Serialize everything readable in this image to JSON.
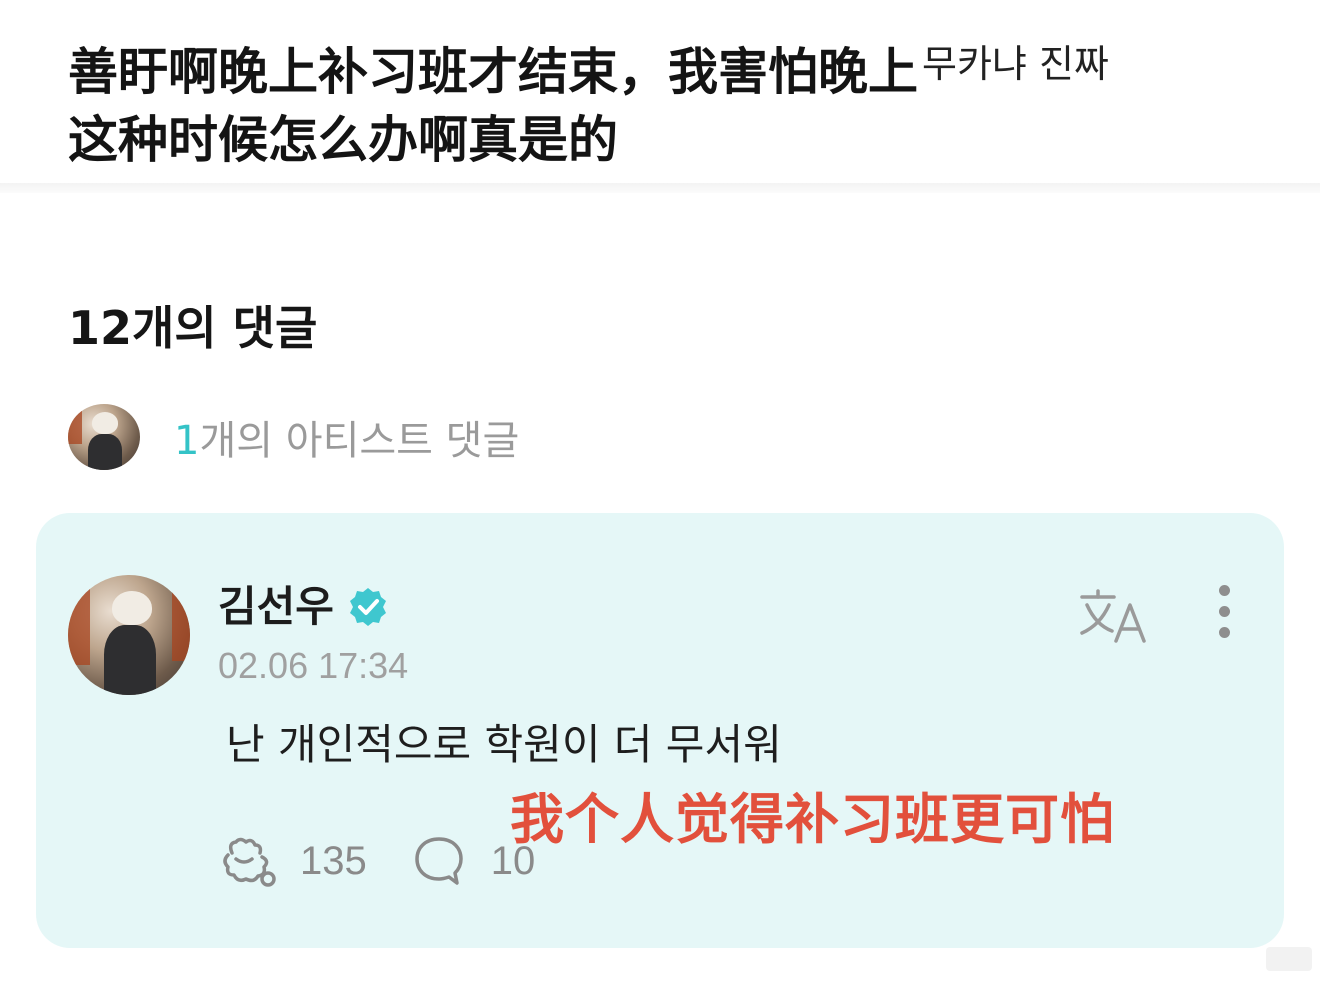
{
  "post": {
    "line1": "善盱啊晚上补习班才结束，我害怕晚上",
    "overlay_korean": "무카냐 진짜",
    "line2": "这种时候怎么办啊真是的"
  },
  "comments": {
    "count_label": "12개의 댓글",
    "artist_count": "1",
    "artist_label": "개의 아티스트 댓글"
  },
  "comment": {
    "author": "김선우",
    "timestamp": "02.06 17:34",
    "text": "난 개인적으로 학원이 더 무서워",
    "translation_overlay": "我个人觉得补习班更可怕",
    "likes": "135",
    "replies": "10"
  },
  "icons": {
    "verified": "verified-badge-icon",
    "translate": "translate-icon",
    "more": "more-vertical-icon",
    "like": "like-paw-icon",
    "reply": "reply-bubble-icon"
  },
  "colors": {
    "accent_teal": "#34c3c7",
    "card_bg": "#e5f7f7",
    "overlay_red": "#e2503c"
  }
}
